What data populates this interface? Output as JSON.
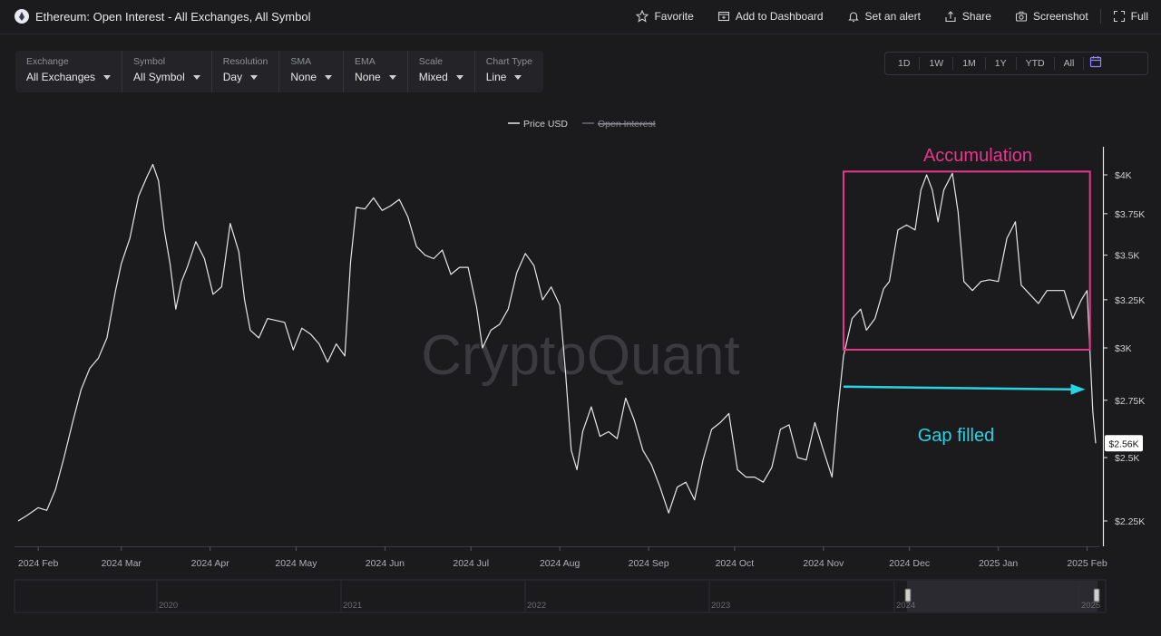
{
  "header": {
    "title": "Ethereum: Open Interest - All Exchanges, All Symbol",
    "actions": [
      {
        "name": "favorite",
        "label": "Favorite",
        "icon": "star-icon"
      },
      {
        "name": "add-to-dashboard",
        "label": "Add to Dashboard",
        "icon": "dashboard-add-icon"
      },
      {
        "name": "set-alert",
        "label": "Set an alert",
        "icon": "bell-icon"
      },
      {
        "name": "share",
        "label": "Share",
        "icon": "share-icon"
      },
      {
        "name": "screenshot",
        "label": "Screenshot",
        "icon": "camera-icon"
      },
      {
        "name": "full",
        "label": "Full",
        "icon": "fullscreen-icon"
      }
    ]
  },
  "controls": [
    {
      "name": "exchange",
      "label": "Exchange",
      "value": "All Exchanges"
    },
    {
      "name": "symbol",
      "label": "Symbol",
      "value": "All Symbol"
    },
    {
      "name": "resolution",
      "label": "Resolution",
      "value": "Day"
    },
    {
      "name": "sma",
      "label": "SMA",
      "value": "None"
    },
    {
      "name": "ema",
      "label": "EMA",
      "value": "None"
    },
    {
      "name": "scale",
      "label": "Scale",
      "value": "Mixed"
    },
    {
      "name": "chart-type",
      "label": "Chart Type",
      "value": "Line"
    }
  ],
  "ranges": [
    "1D",
    "1W",
    "1M",
    "1Y",
    "YTD",
    "All"
  ],
  "watermark": "CryptoQuant",
  "colors": {
    "background": "#1b1b1e",
    "line": "#e6e6e6",
    "accumulation": "#e8358e",
    "gap_arrow": "#29d3e3"
  },
  "chart_data": {
    "type": "line",
    "legend": [
      {
        "name": "Price USD",
        "visible": true
      },
      {
        "name": "Open Interest",
        "visible": false
      }
    ],
    "legend_placement": "top-center",
    "x_tick_labels": [
      "2024 Feb",
      "2024 Mar",
      "2024 Apr",
      "2024 May",
      "2024 Jun",
      "2024 Jul",
      "2024 Aug",
      "2024 Sep",
      "2024 Oct",
      "2024 Nov",
      "2024 Dec",
      "2025 Jan",
      "2025 Feb"
    ],
    "y_tick_labels": [
      "$4K",
      "$3.75K",
      "$3.5K",
      "$3.25K",
      "$3K",
      "$2.75K",
      "$2.5K",
      "$2.25K"
    ],
    "y_ticks": [
      4000,
      3750,
      3500,
      3250,
      3000,
      2750,
      2500,
      2250
    ],
    "ylim": [
      2000,
      4200
    ],
    "scale": "Mixed",
    "grid": false,
    "last_value_label": "$2.56K",
    "last_value": 2560,
    "series": [
      {
        "name": "Price USD",
        "points": [
          [
            "2024-01-25",
            2250
          ],
          [
            "2024-01-28",
            2270
          ],
          [
            "2024-02-01",
            2300
          ],
          [
            "2024-02-04",
            2290
          ],
          [
            "2024-02-07",
            2370
          ],
          [
            "2024-02-10",
            2500
          ],
          [
            "2024-02-13",
            2650
          ],
          [
            "2024-02-16",
            2800
          ],
          [
            "2024-02-19",
            2900
          ],
          [
            "2024-02-22",
            2950
          ],
          [
            "2024-02-25",
            3050
          ],
          [
            "2024-02-28",
            3300
          ],
          [
            "2024-03-01",
            3450
          ],
          [
            "2024-03-04",
            3600
          ],
          [
            "2024-03-07",
            3860
          ],
          [
            "2024-03-10",
            3990
          ],
          [
            "2024-03-12",
            4070
          ],
          [
            "2024-03-14",
            3960
          ],
          [
            "2024-03-16",
            3650
          ],
          [
            "2024-03-18",
            3450
          ],
          [
            "2024-03-20",
            3200
          ],
          [
            "2024-03-22",
            3350
          ],
          [
            "2024-03-24",
            3430
          ],
          [
            "2024-03-27",
            3580
          ],
          [
            "2024-03-30",
            3480
          ],
          [
            "2024-04-02",
            3280
          ],
          [
            "2024-04-05",
            3320
          ],
          [
            "2024-04-08",
            3690
          ],
          [
            "2024-04-11",
            3520
          ],
          [
            "2024-04-13",
            3250
          ],
          [
            "2024-04-15",
            3090
          ],
          [
            "2024-04-18",
            3050
          ],
          [
            "2024-04-21",
            3150
          ],
          [
            "2024-04-24",
            3140
          ],
          [
            "2024-04-27",
            3130
          ],
          [
            "2024-04-30",
            2990
          ],
          [
            "2024-05-03",
            3100
          ],
          [
            "2024-05-06",
            3070
          ],
          [
            "2024-05-09",
            3020
          ],
          [
            "2024-05-12",
            2930
          ],
          [
            "2024-05-15",
            3020
          ],
          [
            "2024-05-18",
            2960
          ],
          [
            "2024-05-20",
            3460
          ],
          [
            "2024-05-22",
            3790
          ],
          [
            "2024-05-25",
            3780
          ],
          [
            "2024-05-28",
            3850
          ],
          [
            "2024-05-31",
            3770
          ],
          [
            "2024-06-03",
            3800
          ],
          [
            "2024-06-06",
            3840
          ],
          [
            "2024-06-09",
            3730
          ],
          [
            "2024-06-12",
            3550
          ],
          [
            "2024-06-15",
            3500
          ],
          [
            "2024-06-18",
            3480
          ],
          [
            "2024-06-21",
            3530
          ],
          [
            "2024-06-24",
            3390
          ],
          [
            "2024-06-27",
            3430
          ],
          [
            "2024-06-30",
            3430
          ],
          [
            "2024-07-03",
            3210
          ],
          [
            "2024-07-05",
            3000
          ],
          [
            "2024-07-08",
            3090
          ],
          [
            "2024-07-11",
            3120
          ],
          [
            "2024-07-14",
            3200
          ],
          [
            "2024-07-17",
            3400
          ],
          [
            "2024-07-20",
            3510
          ],
          [
            "2024-07-23",
            3440
          ],
          [
            "2024-07-26",
            3250
          ],
          [
            "2024-07-29",
            3320
          ],
          [
            "2024-08-01",
            3220
          ],
          [
            "2024-08-03",
            2880
          ],
          [
            "2024-08-05",
            2530
          ],
          [
            "2024-08-07",
            2450
          ],
          [
            "2024-08-09",
            2610
          ],
          [
            "2024-08-12",
            2720
          ],
          [
            "2024-08-15",
            2590
          ],
          [
            "2024-08-18",
            2610
          ],
          [
            "2024-08-21",
            2580
          ],
          [
            "2024-08-24",
            2760
          ],
          [
            "2024-08-27",
            2660
          ],
          [
            "2024-08-30",
            2530
          ],
          [
            "2024-09-02",
            2470
          ],
          [
            "2024-09-05",
            2380
          ],
          [
            "2024-09-08",
            2280
          ],
          [
            "2024-09-11",
            2380
          ],
          [
            "2024-09-14",
            2400
          ],
          [
            "2024-09-17",
            2330
          ],
          [
            "2024-09-20",
            2490
          ],
          [
            "2024-09-23",
            2620
          ],
          [
            "2024-09-26",
            2650
          ],
          [
            "2024-09-29",
            2690
          ],
          [
            "2024-10-02",
            2450
          ],
          [
            "2024-10-05",
            2420
          ],
          [
            "2024-10-08",
            2420
          ],
          [
            "2024-10-11",
            2400
          ],
          [
            "2024-10-14",
            2460
          ],
          [
            "2024-10-17",
            2620
          ],
          [
            "2024-10-20",
            2640
          ],
          [
            "2024-10-23",
            2500
          ],
          [
            "2024-10-26",
            2490
          ],
          [
            "2024-10-29",
            2650
          ],
          [
            "2024-11-01",
            2530
          ],
          [
            "2024-11-04",
            2420
          ],
          [
            "2024-11-06",
            2700
          ],
          [
            "2024-11-08",
            2960
          ],
          [
            "2024-11-11",
            3150
          ],
          [
            "2024-11-14",
            3200
          ],
          [
            "2024-11-16",
            3090
          ],
          [
            "2024-11-19",
            3150
          ],
          [
            "2024-11-22",
            3310
          ],
          [
            "2024-11-24",
            3350
          ],
          [
            "2024-11-27",
            3650
          ],
          [
            "2024-11-30",
            3680
          ],
          [
            "2024-12-03",
            3650
          ],
          [
            "2024-12-05",
            3900
          ],
          [
            "2024-12-07",
            4000
          ],
          [
            "2024-12-09",
            3900
          ],
          [
            "2024-12-11",
            3700
          ],
          [
            "2024-12-13",
            3900
          ],
          [
            "2024-12-16",
            4010
          ],
          [
            "2024-12-18",
            3760
          ],
          [
            "2024-12-20",
            3350
          ],
          [
            "2024-12-23",
            3300
          ],
          [
            "2024-12-26",
            3350
          ],
          [
            "2024-12-29",
            3360
          ],
          [
            "2025-01-01",
            3350
          ],
          [
            "2025-01-04",
            3600
          ],
          [
            "2025-01-07",
            3700
          ],
          [
            "2025-01-09",
            3330
          ],
          [
            "2025-01-12",
            3280
          ],
          [
            "2025-01-15",
            3230
          ],
          [
            "2025-01-18",
            3300
          ],
          [
            "2025-01-21",
            3300
          ],
          [
            "2025-01-24",
            3300
          ],
          [
            "2025-01-27",
            3150
          ],
          [
            "2025-01-30",
            3250
          ],
          [
            "2025-02-01",
            3300
          ],
          [
            "2025-02-03",
            2700
          ],
          [
            "2025-02-04",
            2560
          ]
        ]
      }
    ],
    "annotations": [
      {
        "type": "box",
        "label": "Accumulation",
        "x_range": [
          "2024-11-08",
          "2025-02-02"
        ],
        "y_range": [
          3000,
          4010
        ]
      },
      {
        "type": "arrow",
        "label": "Gap filled",
        "x_range": [
          "2024-11-08",
          "2025-02-01"
        ],
        "y": 2800
      }
    ]
  },
  "navigator": {
    "years": [
      "2020",
      "2021",
      "2022",
      "2023",
      "2024",
      "2025"
    ]
  }
}
